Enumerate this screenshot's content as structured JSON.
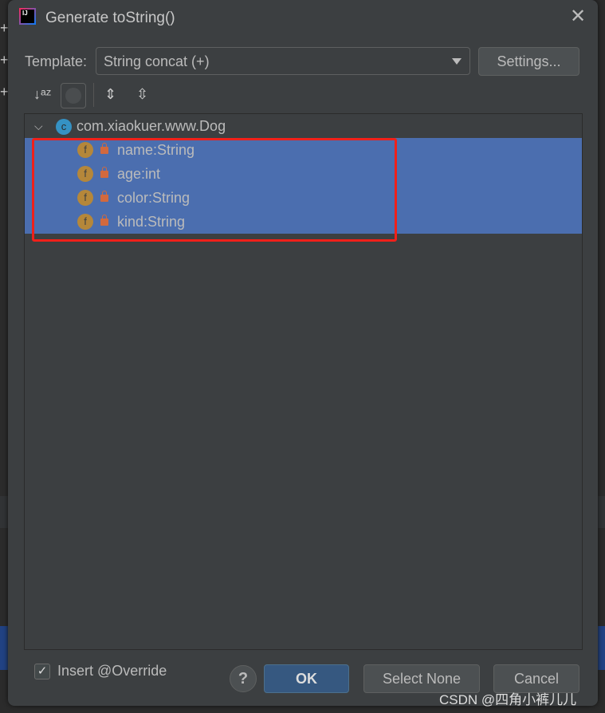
{
  "dialog": {
    "title": "Generate toString()",
    "template_label": "Template:",
    "template_value": "String concat (+)",
    "settings_label": "Settings..."
  },
  "tree": {
    "root": "com.xiaokuer.www.Dog",
    "fields": [
      "name:String",
      "age:int",
      "color:String",
      "kind:String"
    ]
  },
  "footer": {
    "insert_override": "Insert @Override",
    "insert_override_checked": true,
    "help": "?",
    "ok": "OK",
    "select_none": "Select None",
    "cancel": "Cancel"
  },
  "watermark": "CSDN @四角小裤儿儿",
  "colors": {
    "selection": "#4b6eaf",
    "highlight_box": "#f0201a",
    "dialog_bg": "#3c3f41"
  }
}
